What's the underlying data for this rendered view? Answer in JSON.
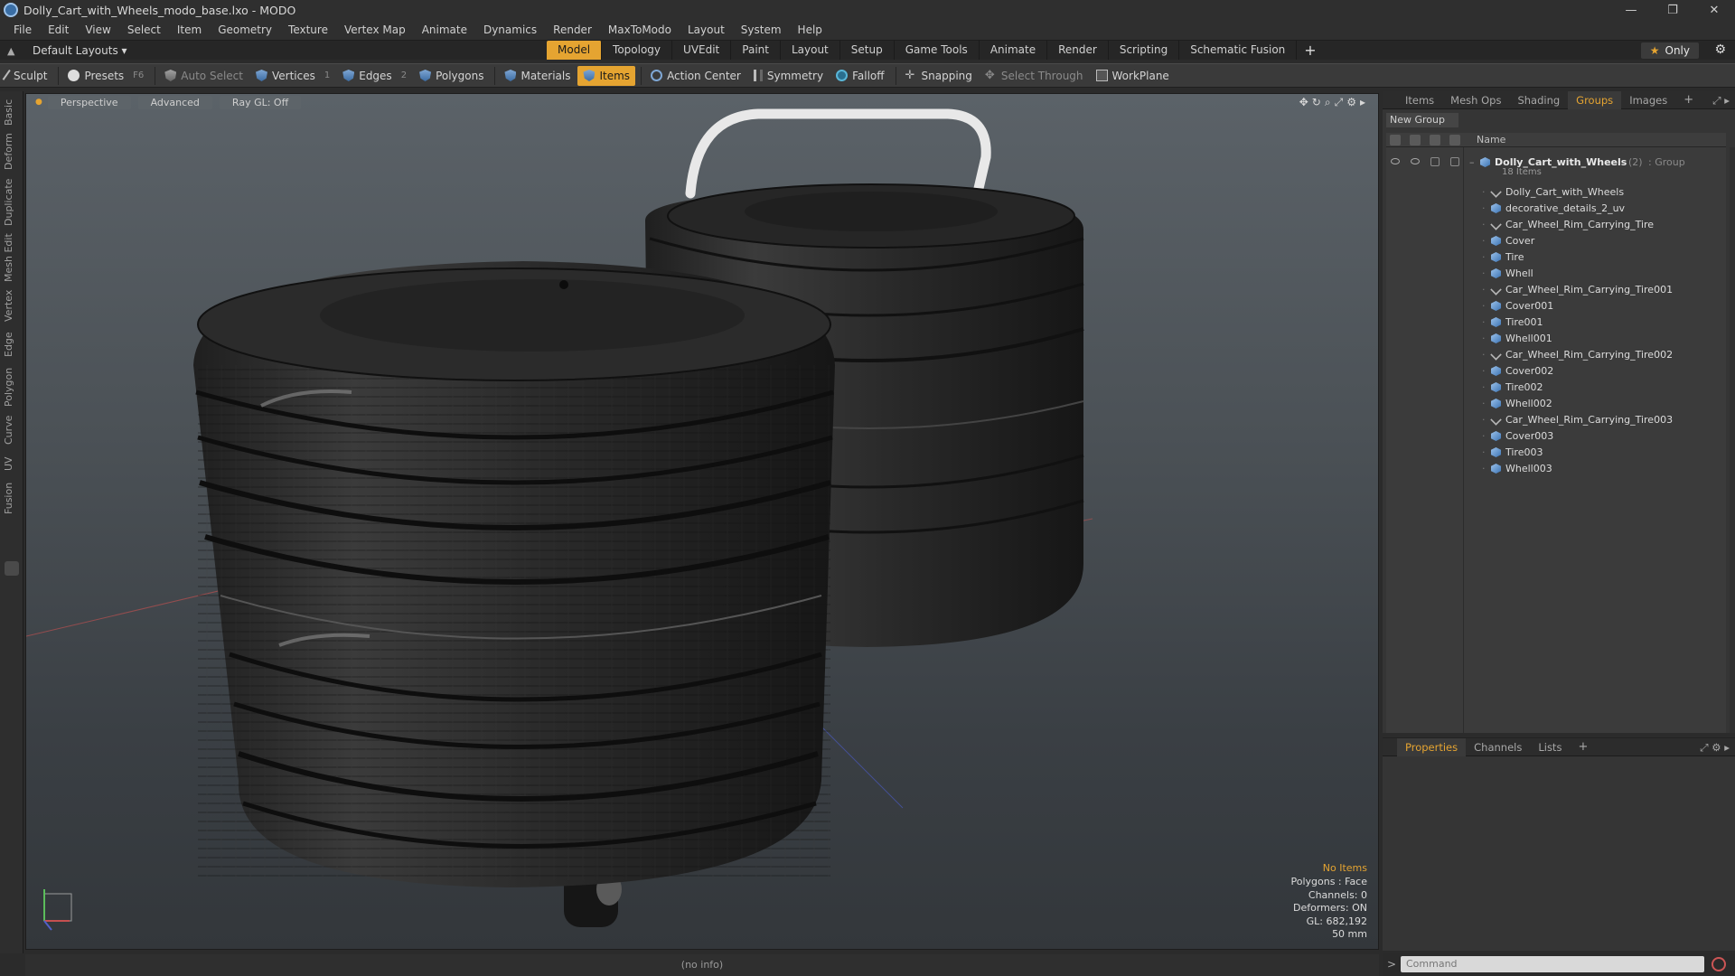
{
  "window": {
    "title": "Dolly_Cart_with_Wheels_modo_base.lxo - MODO",
    "controls": [
      "—",
      "❐",
      "✕"
    ]
  },
  "menu": [
    "File",
    "Edit",
    "View",
    "Select",
    "Item",
    "Geometry",
    "Texture",
    "Vertex Map",
    "Animate",
    "Dynamics",
    "Render",
    "MaxToModo",
    "Layout",
    "System",
    "Help"
  ],
  "layouts": {
    "label": "Default Layouts ▾"
  },
  "tabs": [
    {
      "label": "Model",
      "active": true
    },
    {
      "label": "Topology"
    },
    {
      "label": "UVEdit"
    },
    {
      "label": "Paint"
    },
    {
      "label": "Layout"
    },
    {
      "label": "Setup"
    },
    {
      "label": "Game Tools"
    },
    {
      "label": "Animate"
    },
    {
      "label": "Render"
    },
    {
      "label": "Scripting"
    },
    {
      "label": "Schematic Fusion"
    }
  ],
  "only_label": "Only",
  "toolbar": {
    "sculpt": "Sculpt",
    "presets": "Presets",
    "presets_key": "F6",
    "auto_select": "Auto Select",
    "vertices": "Vertices",
    "vertices_key": "1",
    "edges": "Edges",
    "edges_key": "2",
    "polygons": "Polygons",
    "materials": "Materials",
    "items": "Items",
    "action_center": "Action Center",
    "symmetry": "Symmetry",
    "falloff": "Falloff",
    "snapping": "Snapping",
    "select_through": "Select Through",
    "workplane": "WorkPlane"
  },
  "left_tabs": [
    "Basic",
    "Deform",
    "Duplicate",
    "Mesh Edit",
    "Vertex",
    "Edge",
    "Polygon",
    "Curve",
    "UV",
    "Fusion"
  ],
  "viewport": {
    "view": "Perspective",
    "mode": "Advanced",
    "raygl": "Ray GL: Off",
    "info": {
      "no_items": "No Items",
      "polygons": "Polygons : Face",
      "channels": "Channels: 0",
      "deformers": "Deformers: ON",
      "gl": "GL: 682,192",
      "scale": "50 mm"
    }
  },
  "status": "(no info)",
  "panel_tabs": [
    {
      "label": "Items"
    },
    {
      "label": "Mesh Ops"
    },
    {
      "label": "Shading"
    },
    {
      "label": "Groups",
      "active": true
    },
    {
      "label": "Images"
    }
  ],
  "groups": {
    "new_group": "New Group",
    "name_col": "Name",
    "root": {
      "name": "Dolly_Cart_with_Wheels",
      "count": "(2)",
      "type": ": Group",
      "sub": "18 Items"
    },
    "items": [
      {
        "name": "Dolly_Cart_with_Wheels",
        "kind": "loc"
      },
      {
        "name": "decorative_details_2_uv",
        "kind": "mesh"
      },
      {
        "name": "Car_Wheel_Rim_Carrying_Tire",
        "kind": "loc"
      },
      {
        "name": "Cover",
        "kind": "mesh"
      },
      {
        "name": "Tire",
        "kind": "mesh"
      },
      {
        "name": "Whell",
        "kind": "mesh"
      },
      {
        "name": "Car_Wheel_Rim_Carrying_Tire001",
        "kind": "loc"
      },
      {
        "name": "Cover001",
        "kind": "mesh"
      },
      {
        "name": "Tire001",
        "kind": "mesh"
      },
      {
        "name": "Whell001",
        "kind": "mesh"
      },
      {
        "name": "Car_Wheel_Rim_Carrying_Tire002",
        "kind": "loc"
      },
      {
        "name": "Cover002",
        "kind": "mesh"
      },
      {
        "name": "Tire002",
        "kind": "mesh"
      },
      {
        "name": "Whell002",
        "kind": "mesh"
      },
      {
        "name": "Car_Wheel_Rim_Carrying_Tire003",
        "kind": "loc"
      },
      {
        "name": "Cover003",
        "kind": "mesh"
      },
      {
        "name": "Tire003",
        "kind": "mesh"
      },
      {
        "name": "Whell003",
        "kind": "mesh"
      }
    ]
  },
  "prop_tabs": [
    {
      "label": "Properties",
      "active": true
    },
    {
      "label": "Channels"
    },
    {
      "label": "Lists"
    }
  ],
  "command": {
    "placeholder": "Command"
  },
  "colors": {
    "accent": "#e5a431",
    "viewport_top": "#5b6268",
    "viewport_bottom": "#33373b"
  }
}
